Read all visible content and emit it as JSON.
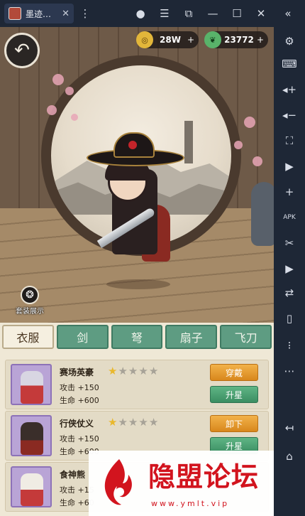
{
  "window": {
    "tab_title": "墨迹…",
    "tab_close": "✕",
    "controls": {
      "account": "●",
      "menu": "☰",
      "restore": "⧉",
      "minimize": "—",
      "maximize": "☐",
      "close": "✕",
      "collapse": "«"
    },
    "more": "⋮"
  },
  "sidebar": {
    "icons": [
      "gear-icon",
      "keyboard-icon",
      "volume-up-icon",
      "volume-down-icon",
      "screenshot-icon",
      "record-icon",
      "add-app-icon",
      "apk-icon",
      "scissors-icon",
      "video-icon",
      "sync-icon",
      "shake-icon",
      "macro-icon",
      "more-icon",
      "back-icon",
      "home-icon"
    ],
    "glyphs": [
      "⚙",
      "⌨",
      "◂+",
      "◂−",
      "⛶",
      "▶",
      "+",
      "APK",
      "✂",
      "▶",
      "⇄",
      "▯",
      "⁝",
      "⋯",
      "↤",
      "⌂"
    ]
  },
  "game": {
    "back_label": "↶",
    "currency": {
      "coin_value": "28W",
      "coin_glyph": "◎",
      "jade_value": "23772",
      "jade_glyph": "❦",
      "plus": "+"
    },
    "suit_display_label": "套装展示",
    "suit_display_glyph": "❂"
  },
  "categories": [
    {
      "label": "衣服",
      "active": true
    },
    {
      "label": "剑",
      "active": false
    },
    {
      "label": "弩",
      "active": false
    },
    {
      "label": "扇子",
      "active": false
    },
    {
      "label": "飞刀",
      "active": false
    }
  ],
  "items": [
    {
      "name": "赛场英豪",
      "stars_on": 1,
      "stars_total": 5,
      "attack": "攻击 +150",
      "hp": "生命 +600",
      "primary_button": "穿戴",
      "secondary_button": "升星"
    },
    {
      "name": "行侠仗义",
      "stars_on": 1,
      "stars_total": 5,
      "attack": "攻击 +150",
      "hp": "生命 +600",
      "primary_button": "卸下",
      "secondary_button": "升星"
    },
    {
      "name": "食神熊",
      "stars_on": 0,
      "stars_total": 0,
      "attack": "攻击 +15",
      "hp": "生命 +60",
      "primary_button": "",
      "secondary_button": ""
    }
  ],
  "star_glyph": "★",
  "watermark": {
    "title": "隐盟论坛",
    "url": "www.ymlt.vip"
  },
  "colors": {
    "accent_green": "#5e9c82",
    "accent_orange": "#e09a2c",
    "watermark_red": "#d2141e"
  }
}
